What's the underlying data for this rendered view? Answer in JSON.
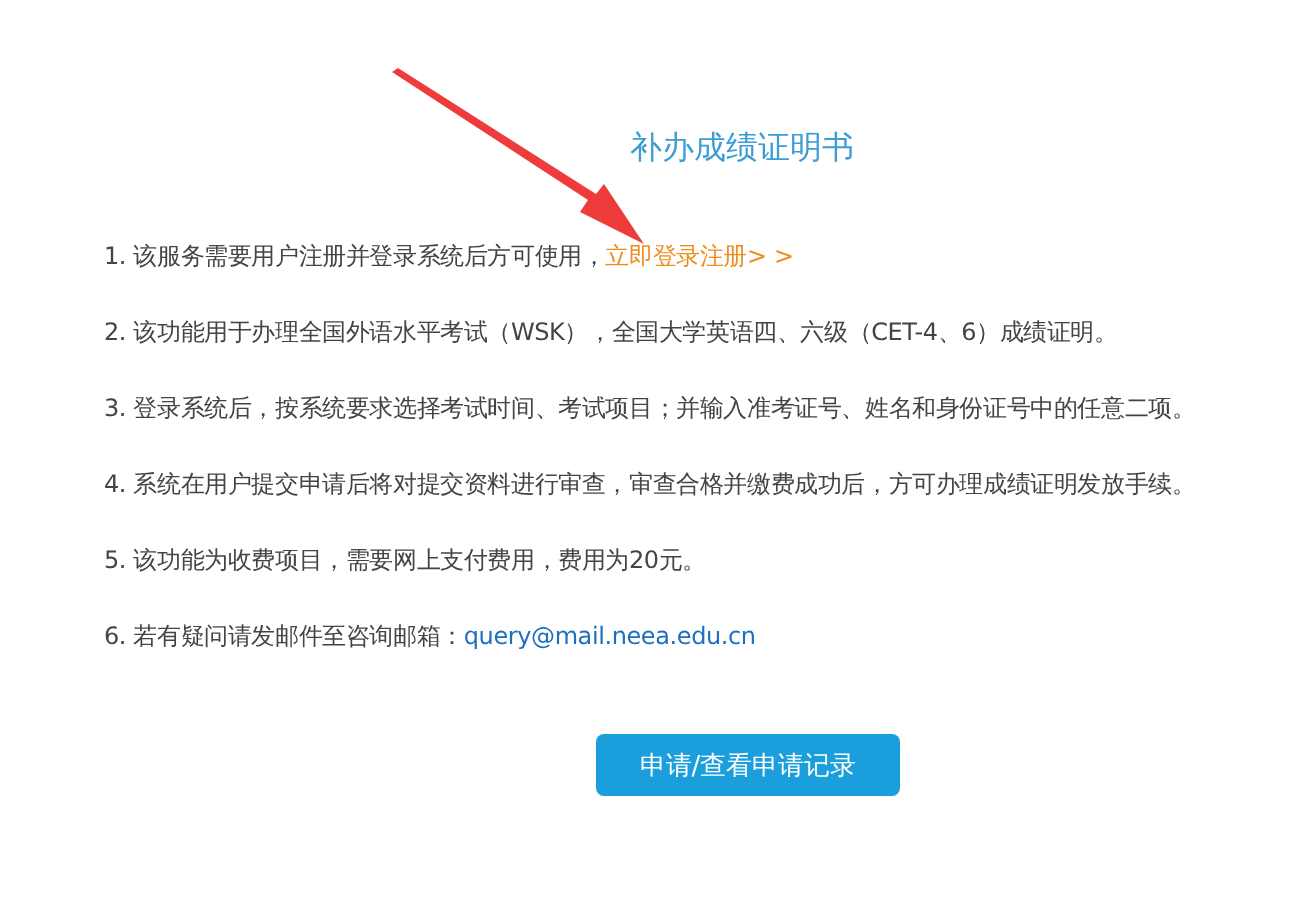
{
  "title": "补办成绩证明书",
  "items": [
    {
      "text": "1. 该服务需要用户注册并登录系统后方可使用，",
      "link": {
        "text": "立即登录注册> >",
        "kind": "register"
      }
    },
    {
      "text": "2. 该功能用于办理全国外语水平考试（WSK），全国大学英语四、六级（CET-4、6）成绩证明。"
    },
    {
      "text": "3. 登录系统后，按系统要求选择考试时间、考试项目；并输入准考证号、姓名和身份证号中的任意二项。"
    },
    {
      "text": "4. 系统在用户提交申请后将对提交资料进行审查，审查合格并缴费成功后，方可办理成绩证明发放手续。"
    },
    {
      "text": "5. 该功能为收费项目，需要网上支付费用，费用为20元。"
    },
    {
      "text": "6. 若有疑问请发邮件至咨询邮箱：",
      "link": {
        "text": "query@mail.neea.edu.cn",
        "kind": "email"
      }
    }
  ],
  "button": "申请/查看申请记录",
  "annotation": {
    "kind": "arrow"
  }
}
